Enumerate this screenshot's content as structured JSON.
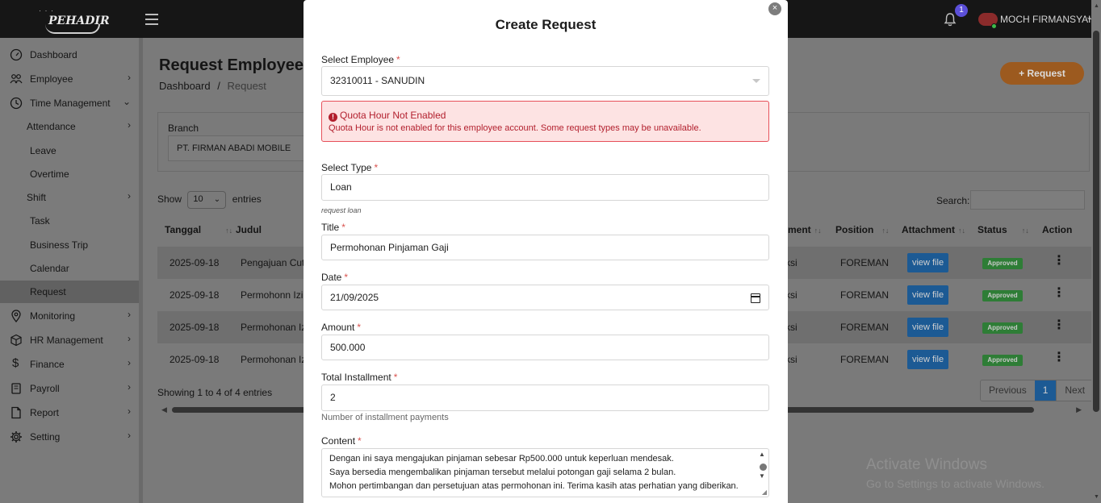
{
  "topbar": {
    "logo_text": "PEHADIR",
    "notification_count": "1",
    "user_name": "MOCH FIRMANSYAH"
  },
  "sidebar": {
    "items": [
      {
        "label": "Dashboard",
        "icon": "gauge-icon"
      },
      {
        "label": "Employee",
        "icon": "people-icon"
      },
      {
        "label": "Time Management",
        "icon": "clock-icon"
      },
      {
        "label": "Attendance"
      },
      {
        "label": "Leave"
      },
      {
        "label": "Overtime"
      },
      {
        "label": "Shift"
      },
      {
        "label": "Task"
      },
      {
        "label": "Business Trip"
      },
      {
        "label": "Calendar"
      },
      {
        "label": "Request"
      },
      {
        "label": "Monitoring",
        "icon": "map-pin-icon"
      },
      {
        "label": "HR Management",
        "icon": "box-icon"
      },
      {
        "label": "Finance",
        "icon": "dollar-icon"
      },
      {
        "label": "Payroll",
        "icon": "book-icon"
      },
      {
        "label": "Report",
        "icon": "file-icon"
      },
      {
        "label": "Setting",
        "icon": "gear-icon"
      }
    ],
    "active": "Request"
  },
  "page": {
    "title": "Request Employee",
    "breadcrumb": {
      "home": "Dashboard",
      "separator": "/",
      "current": "Request"
    },
    "request_button": "+ Request",
    "branch_label": "Branch",
    "branch_value": "PT. FIRMAN ABADI MOBILE",
    "show_label": "Show",
    "entries_value": "10",
    "entries_label": "entries",
    "search_label": "Search:",
    "columns": [
      "Tanggal",
      "Judul",
      "ment",
      "Position",
      "Attachment",
      "Status",
      "Action"
    ],
    "rows": [
      {
        "tanggal": "2025-09-18",
        "judul": "Pengajuan Cuti",
        "dept": "ksi",
        "position": "FOREMAN",
        "attachment": "view file",
        "status": "Approved"
      },
      {
        "tanggal": "2025-09-18",
        "judul": "Permohonn Izin",
        "dept": "ksi",
        "position": "FOREMAN",
        "attachment": "view file",
        "status": "Approved"
      },
      {
        "tanggal": "2025-09-18",
        "judul": "Permohonan Izi",
        "dept": "ksi",
        "position": "FOREMAN",
        "attachment": "view file",
        "status": "Approved"
      },
      {
        "tanggal": "2025-09-18",
        "judul": "Permohonan Izi",
        "dept": "ksi",
        "position": "FOREMAN",
        "attachment": "view file",
        "status": "Approved"
      }
    ],
    "showing_text": "Showing 1 to 4 of 4 entries",
    "pagination": {
      "previous": "Previous",
      "current": "1",
      "next": "Next"
    },
    "watermark": {
      "line1": "Activate Windows",
      "line2": "Go to Settings to activate Windows."
    }
  },
  "modal": {
    "title": "Create Request",
    "close": "×",
    "employee_label": "Select Employee",
    "employee_value": "32310011 - SANUDIN",
    "alert": {
      "icon": "!",
      "title": "Quota Hour Not Enabled",
      "text": "Quota Hour is not enabled for this employee account. Some request types may be unavailable."
    },
    "type_label": "Select Type",
    "type_value": "Loan",
    "type_hint": "request loan",
    "title_label": "Title",
    "title_value": "Permohonan Pinjaman Gaji",
    "date_label": "Date",
    "date_value": "21/09/2025",
    "amount_label": "Amount",
    "amount_value": "500.000",
    "installment_label": "Total Installment",
    "installment_value": "2",
    "installment_hint": "Number of installment payments",
    "content_label": "Content",
    "content_lines": [
      "Dengan ini saya mengajukan pinjaman sebesar Rp500.000 untuk keperluan mendesak.",
      "Saya bersedia mengembalikan pinjaman tersebut melalui potongan gaji selama 2 bulan.",
      "Mohon pertimbangan dan persetujuan atas permohonan ini. Terima kasih atas perhatian yang diberikan."
    ],
    "required_mark": "*"
  }
}
